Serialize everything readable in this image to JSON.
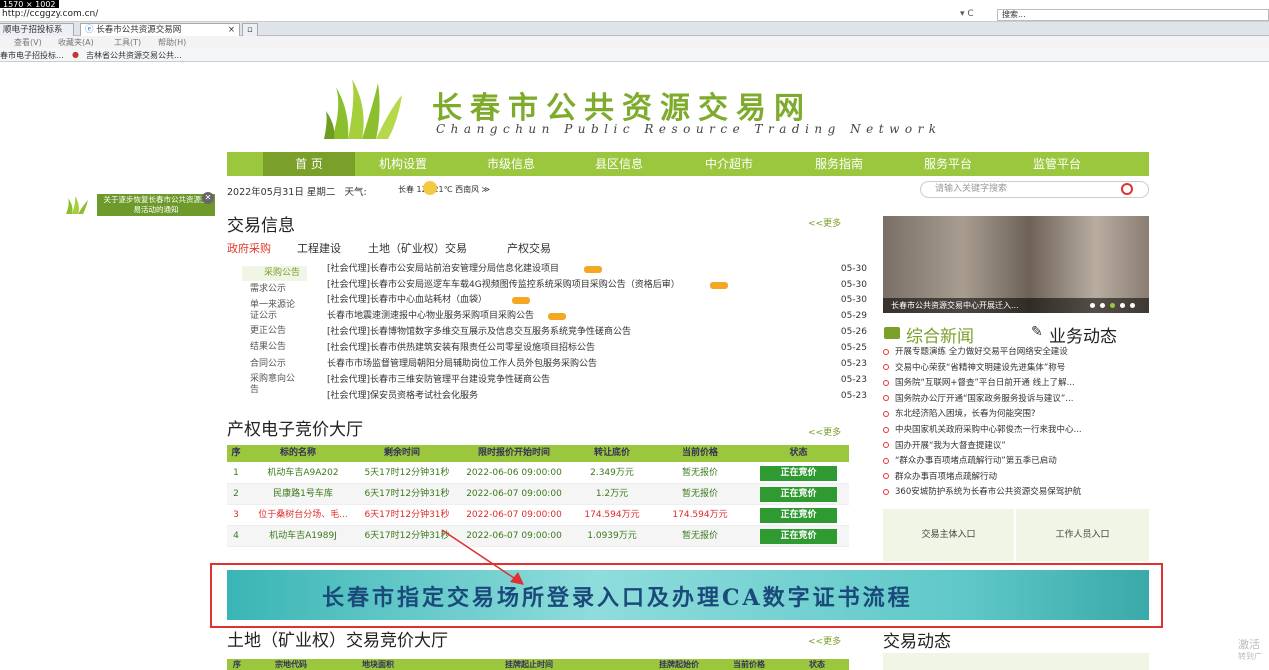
{
  "browser": {
    "dimensions_tag": "1570 × 1002",
    "url": "http://ccggzy.com.cn/",
    "search_placeholder": "搜索...",
    "tabs": [
      {
        "label": "顺电子招投标系统"
      },
      {
        "label": "长春市公共资源交易网"
      }
    ],
    "menus": [
      "查看(V)",
      "收藏夹(A)",
      "工具(T)",
      "帮助(H)"
    ],
    "favorites": [
      "春市电子招投标...",
      "吉林省公共资源交易公共..."
    ]
  },
  "site": {
    "title": "长春市公共资源交易网",
    "subtitle": "Changchun Public Resource Trading Network",
    "nav": [
      "首 页",
      "机构设置",
      "市级信息",
      "县区信息",
      "中介超市",
      "服务指南",
      "服务平台",
      "监管平台"
    ],
    "date": "2022年05月31日 星期二",
    "weather_label": "天气:",
    "weather": "长春  12~21℃ 西南风 ≫",
    "search_placeholder": "请输入关键字搜索",
    "float_notice": "关于逐步恢复长春市公共资源交易活动的通知",
    "float_close": "✕"
  },
  "trade": {
    "title": "交易信息",
    "more": "<<更多",
    "tabs": [
      "政府采购",
      "工程建设",
      "土地（矿业权）交易",
      "产权交易"
    ],
    "side": [
      "采购公告",
      "需求公示",
      "单一来源论证公示",
      "更正公告",
      "结果公告",
      "合同公示",
      "采购意向公告"
    ],
    "rows": [
      {
        "text": "[社会代理]长春市公安局站前治安管理分局信息化建设项目",
        "date": "05-30",
        "new": true
      },
      {
        "text": "[社会代理]长春市公安局巡逻车车载4G视频图传监控系统采购项目采购公告（资格后审）",
        "date": "05-30",
        "new": true
      },
      {
        "text": "[社会代理]长春市中心血站耗材（血袋）",
        "date": "05-30",
        "new": true
      },
      {
        "text": "长春市地震速测速报中心物业服务采购项目采购公告",
        "date": "05-29",
        "new": true
      },
      {
        "text": "[社会代理]长春博物馆数字多维交互展示及信息交互服务系统竞争性磋商公告",
        "date": "05-26",
        "new": false
      },
      {
        "text": "[社会代理]长春市供热建筑安装有限责任公司零星设施项目招标公告",
        "date": "05-25",
        "new": false
      },
      {
        "text": "长春市市场监督管理局朝阳分局辅助岗位工作人员外包服务采购公告",
        "date": "05-23",
        "new": false
      },
      {
        "text": "[社会代理]长春市三维安防管理平台建设竞争性磋商公告",
        "date": "05-23",
        "new": false
      },
      {
        "text": "[社会代理]保安员资格考试社会化服务",
        "date": "05-23",
        "new": false
      }
    ]
  },
  "auction": {
    "title": "产权电子竞价大厅",
    "more": "<<更多",
    "headers": [
      "序",
      "标的名称",
      "剩余时间",
      "限时报价开始时间",
      "转让底价",
      "当前价格",
      "状态"
    ],
    "rows": [
      {
        "no": "1",
        "name": "机动车吉A9A202",
        "left": "5天17时12分钟31秒",
        "start": "2022-06-06 09:00:00",
        "base": "2.349万元",
        "cur": "暂无报价",
        "status": "正在竞价"
      },
      {
        "no": "2",
        "name": "民康路1号车库",
        "left": "6天17时12分钟31秒",
        "start": "2022-06-07 09:00:00",
        "base": "1.2万元",
        "cur": "暂无报价",
        "status": "正在竞价"
      },
      {
        "no": "3",
        "name": "位于桑树台分场、毛...",
        "left": "6天17时12分钟31秒",
        "start": "2022-06-07 09:00:00",
        "base": "174.594万元",
        "cur": "174.594万元",
        "status": "正在竞价"
      },
      {
        "no": "4",
        "name": "机动车吉A1989J",
        "left": "6天17时12分钟31秒",
        "start": "2022-06-07 09:00:00",
        "base": "1.0939万元",
        "cur": "暂无报价",
        "status": "正在竞价"
      }
    ]
  },
  "banner": {
    "text": "长春市指定交易场所登录入口及办理CA数字证书流程"
  },
  "land": {
    "title": "土地（矿业权）交易竞价大厅",
    "more": "<<更多",
    "headers": [
      "序",
      "宗地代码",
      "地块面积",
      "挂牌起止时间",
      "挂牌起始价",
      "当前价格",
      "状态"
    ]
  },
  "right": {
    "photo_caption": "长春市公共资源交易中心开展迁入...",
    "news_title": "综合新闻",
    "biz_title": "业务动态",
    "news": [
      "开展专题演练 全力做好交易平台网络安全建设",
      "交易中心荣获“省精神文明建设先进集体”称号",
      "国务院“互联网+督查”平台日前开通 线上了解...",
      "国务院办公厅开通“国家政务服务投诉与建议”...",
      "东北经济陷入困境，长春为何能突围?",
      "中央国家机关政府采购中心郭俊杰一行来我中心...",
      "国办开展“我为大督查提建议”",
      "“群众办事百项堵点疏解行动”第五季已启动",
      "群众办事百项堵点疏解行动",
      "360安城防护系统为长春市公共资源交易保驾护航"
    ],
    "entry1": "交易主体入口",
    "entry2": "工作人员入口",
    "dynamics_title": "交易动态"
  },
  "watermark": {
    "line1": "激活",
    "line2": "转到广"
  }
}
